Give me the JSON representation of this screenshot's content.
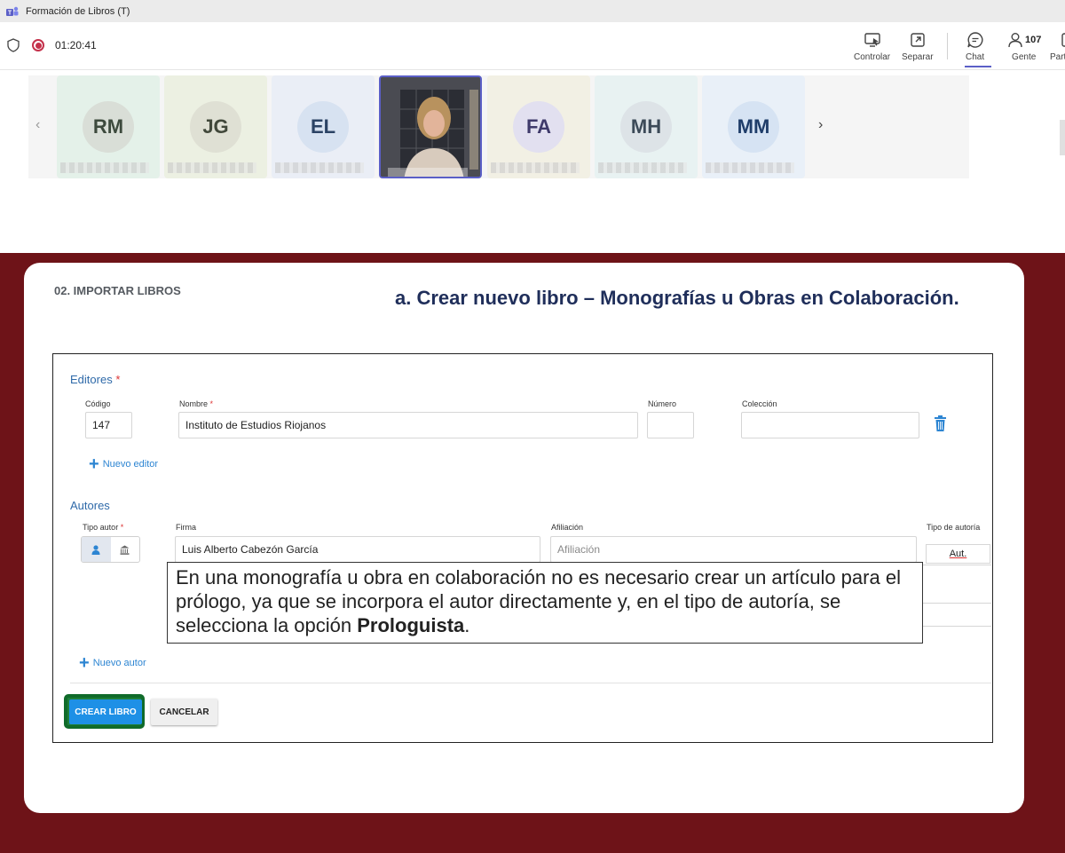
{
  "window": {
    "title": "Formación de Libros (T)",
    "app_icon": "teams-icon"
  },
  "meeting": {
    "timer": "01:20:41",
    "toolbar": [
      {
        "key": "controlar",
        "label": "Controlar",
        "icon": "share-control-icon"
      },
      {
        "key": "separar",
        "label": "Separar",
        "icon": "pop-out-icon"
      },
      {
        "key": "chat",
        "label": "Chat",
        "icon": "chat-icon"
      },
      {
        "key": "gente",
        "label": "Gente",
        "icon": "people-icon",
        "count": "107"
      },
      {
        "key": "part",
        "label": "Part",
        "icon": "part-icon"
      }
    ],
    "participants": [
      {
        "initials": "RM",
        "bg": "#e4f1e9",
        "avatar": "#d9ded7",
        "fg": "#3d4a3d"
      },
      {
        "initials": "JG",
        "bg": "#ecf0e2",
        "avatar": "#dfe0d4",
        "fg": "#41483a"
      },
      {
        "initials": "EL",
        "bg": "#eaeef6",
        "avatar": "#d7e2f1",
        "fg": "#2b4365"
      },
      {
        "initials": "",
        "bg": "#3a3c44",
        "avatar": "",
        "fg": ""
      },
      {
        "initials": "FA",
        "bg": "#f2f0e4",
        "avatar": "#e2e0f0",
        "fg": "#3f3a6b"
      },
      {
        "initials": "MH",
        "bg": "#e8f2f2",
        "avatar": "#dde3e7",
        "fg": "#3c4a58"
      },
      {
        "initials": "MM",
        "bg": "#e9f0f8",
        "avatar": "#d6e3f3",
        "fg": "#1f3d6a"
      }
    ]
  },
  "slide": {
    "section": "02. IMPORTAR LIBROS",
    "heading": "a. Crear nuevo libro – Monografías u Obras en Colaboración.",
    "form": {
      "editores": {
        "title": "Editores",
        "required_mark": "*",
        "codigo_label": "Código",
        "codigo_value": "147",
        "nombre_label": "Nombre",
        "nombre_value": "Instituto de Estudios Riojanos",
        "numero_label": "Número",
        "coleccion_label": "Colección",
        "add_label": "Nuevo editor"
      },
      "autores": {
        "title": "Autores",
        "tipo_label": "Tipo autor",
        "required_mark": "*",
        "firma_label": "Firma",
        "firma_value": "Luis Alberto Cabezón García",
        "afiliacion_label": "Afiliación",
        "afiliacion_placeholder": "Afiliación",
        "tipo_autoria_label": "Tipo de autoría",
        "tipo_autoria_value": "Aut.",
        "add_label": "Nuevo autor"
      },
      "hint_before": "En una monografía u obra en colaboración no es necesario crear un artículo para el prólogo, ya que se incorpora el autor directamente y, en el tipo de autoría, se selecciona la opción ",
      "hint_bold": "Prologuista",
      "hint_after": ".",
      "create_label": "CREAR LIBRO",
      "cancel_label": "CANCELAR"
    }
  },
  "colors": {
    "slide_background": "#6e1318",
    "heading": "#1f2e5a",
    "primary_button": "#1e90e6",
    "highlight": "#106b2a"
  }
}
